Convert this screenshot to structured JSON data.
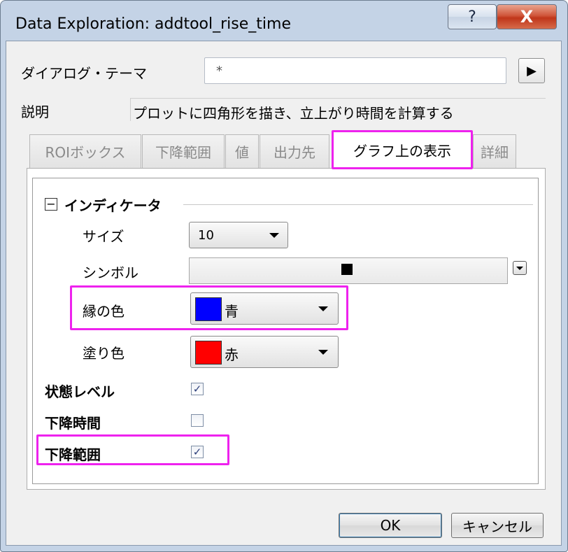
{
  "window": {
    "title": "Data Exploration: addtool_rise_time",
    "help": "?",
    "close": "X"
  },
  "form": {
    "theme_label": "ダイアログ・テーマ",
    "theme_value": "*",
    "theme_arrow": "▶",
    "desc_label": "説明",
    "desc_value": "プロットに四角形を描き、立上がり時間を計算する"
  },
  "tabs": [
    {
      "label": "ROIボックス",
      "active": false
    },
    {
      "label": "下降範囲",
      "active": false
    },
    {
      "label": "値",
      "active": false
    },
    {
      "label": "出力先",
      "active": false
    },
    {
      "label": "グラフ上の表示",
      "active": true
    },
    {
      "label": "詳細",
      "active": false
    }
  ],
  "indicator": {
    "group_label": "インディケータ",
    "collapse_glyph": "−",
    "size_label": "サイズ",
    "size_value": "10",
    "symbol_label": "シンボル",
    "edge_label": "縁の色",
    "edge_value": "青",
    "edge_color": "#0000ff",
    "fill_label": "塗り色",
    "fill_value": "赤",
    "fill_color": "#ff0000"
  },
  "options": {
    "status_label": "状態レベル",
    "status_checked": true,
    "fall_time_label": "下降時間",
    "fall_time_checked": false,
    "fall_range_label": "下降範囲",
    "fall_range_checked": true,
    "check_glyph": "✓"
  },
  "buttons": {
    "ok": "OK",
    "cancel": "キャンセル"
  },
  "colors": {
    "highlight": "#ee22ee"
  }
}
